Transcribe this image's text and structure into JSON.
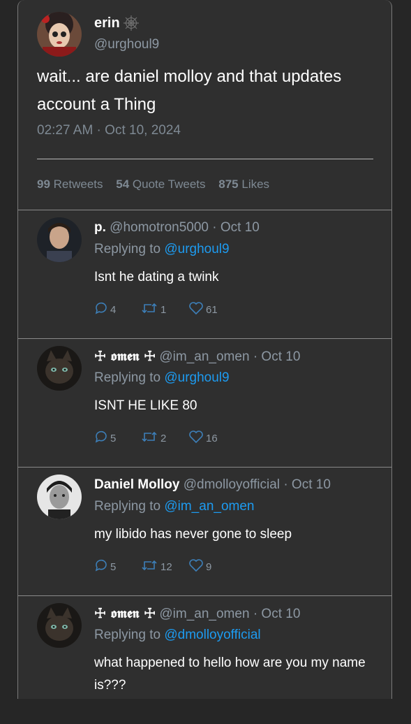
{
  "main_tweet": {
    "author_name": "erin",
    "author_handle": "@urghoul9",
    "text": "wait... are daniel molloy and that updates account a Thing",
    "timestamp": "02:27 AM · Oct 10, 2024",
    "stats": {
      "retweets_count": "99",
      "retweets_label": "Retweets",
      "quotes_count": "54",
      "quotes_label": "Quote Tweets",
      "likes_count": "875",
      "likes_label": "Likes"
    }
  },
  "replies": [
    {
      "name": "p.",
      "handle": "@homotron5000",
      "date": "· Oct 10",
      "replying_label": "Replying to",
      "replying_to": "@urghoul9",
      "text": "Isnt he dating a twink",
      "replies": "4",
      "retweets": "1",
      "likes": "61"
    },
    {
      "name": "☩ 𝖔𝖒𝖊𝖓 ☩",
      "handle": "@im_an_omen",
      "date": "· Oct 10",
      "replying_label": "Replying to",
      "replying_to": "@urghoul9",
      "text": "ISNT HE LIKE 80",
      "replies": "5",
      "retweets": "2",
      "likes": "16"
    },
    {
      "name": "Daniel Molloy",
      "handle": "@dmolloyofficial",
      "date": "· Oct 10",
      "replying_label": "Replying to",
      "replying_to": "@im_an_omen",
      "text": "my libido has never gone to sleep",
      "replies": "5",
      "retweets": "12",
      "likes": "9"
    },
    {
      "name": "☩ 𝖔𝖒𝖊𝖓 ☩",
      "handle": "@im_an_omen",
      "date": "· Oct 10",
      "replying_label": "Replying to",
      "replying_to": "@dmolloyofficial",
      "text": "what happened to hello how are you my name is???",
      "replies": "",
      "retweets": "",
      "likes": ""
    }
  ],
  "colors": {
    "background": "#262626",
    "card": "#2f2f2f",
    "muted_text": "#8d98a3",
    "link": "#1d9bf0"
  }
}
